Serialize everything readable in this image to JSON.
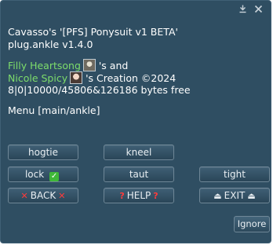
{
  "window": {
    "icons": [
      "pin-icon",
      "close-icon"
    ]
  },
  "message": {
    "line1": "Cavasso's '[PFS] Ponysuit v1 BETA'",
    "line2": "plug.ankle v1.4.0",
    "owner1_name": "Filly Heartsong",
    "owner1_suffix": "'s and",
    "owner2_name": "Nicole Spicy",
    "owner2_suffix": "'s Creation ©2024",
    "line5": "8|0|10000/45806&126186 bytes free",
    "line6": "Menu [main/ankle]"
  },
  "buttons": {
    "hogtie": "hogtie",
    "kneel": "kneel",
    "lock": "lock",
    "taut": "taut",
    "tight": "tight",
    "back": "BACK",
    "help": "HELP",
    "exit": "EXIT",
    "ignore": "Ignore"
  },
  "colors": {
    "background": "#2f4e62",
    "link": "#7ddd6b"
  }
}
